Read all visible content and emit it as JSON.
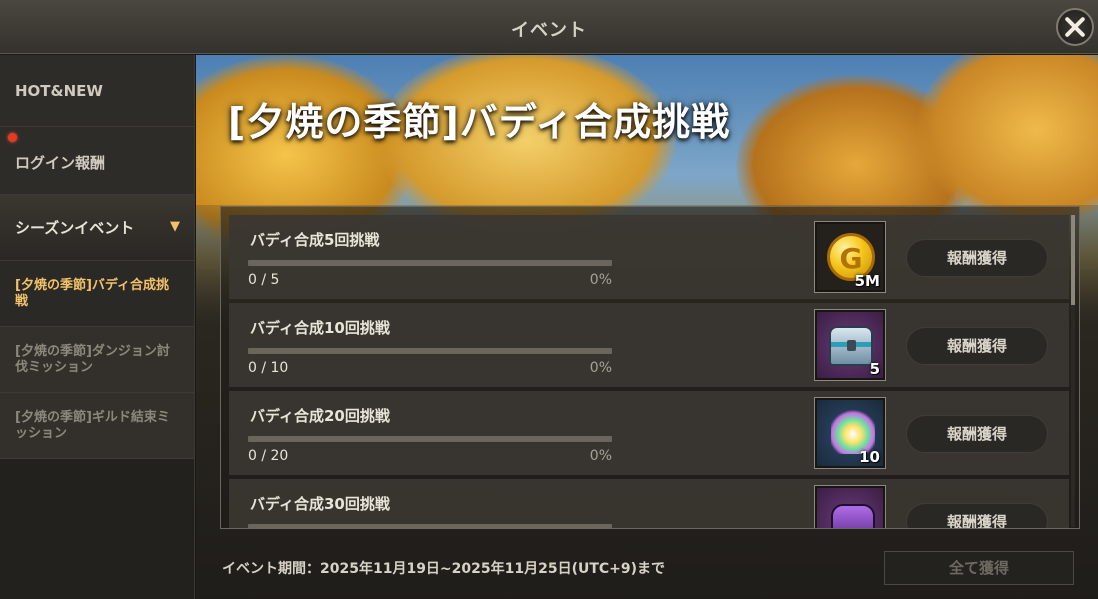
{
  "window": {
    "title": "イベント"
  },
  "sidebar": {
    "items": [
      {
        "label": "HOT&NEW"
      },
      {
        "label": "ログイン報酬",
        "badge": "red-dot"
      },
      {
        "label": "シーズンイベント",
        "expanded": true
      }
    ],
    "sub_items": [
      {
        "label": "[夕焼の季節]バディ合成挑戦",
        "active": true
      },
      {
        "label": "[夕焼の季節]ダンジョン討伐ミッション",
        "active": false
      },
      {
        "label": "[夕焼の季節]ギルド結束ミッション",
        "active": false
      }
    ]
  },
  "event": {
    "title": "[夕焼の季節]バディ合成挑戦",
    "period": "イベント期間：2025年11月19日~2025年11月25日(UTC+9)まで",
    "claim_all_label": "全て獲得"
  },
  "missions": [
    {
      "name": "バディ合成5回挑戦",
      "count": "0 / 5",
      "percent": "0%",
      "progress": 0,
      "reward_icon": "gold-coin-icon",
      "reward_qty": "5M",
      "button": "報酬獲得"
    },
    {
      "name": "バディ合成10回挑戦",
      "count": "0 / 10",
      "percent": "0%",
      "progress": 0,
      "reward_icon": "treasure-chest-icon",
      "reward_qty": "5",
      "button": "報酬獲得"
    },
    {
      "name": "バディ合成20回挑戦",
      "count": "0 / 20",
      "percent": "0%",
      "progress": 0,
      "reward_icon": "crystal-icon",
      "reward_qty": "10",
      "button": "報酬獲得"
    },
    {
      "name": "バディ合成30回挑戦",
      "count": "",
      "percent": "",
      "progress": 0,
      "reward_icon": "purple-chest-icon",
      "reward_qty": "",
      "button": "報酬獲得"
    }
  ],
  "colors": {
    "accent": "#f2c36b",
    "alert": "#e83a1f",
    "panel": "#3a3732"
  }
}
